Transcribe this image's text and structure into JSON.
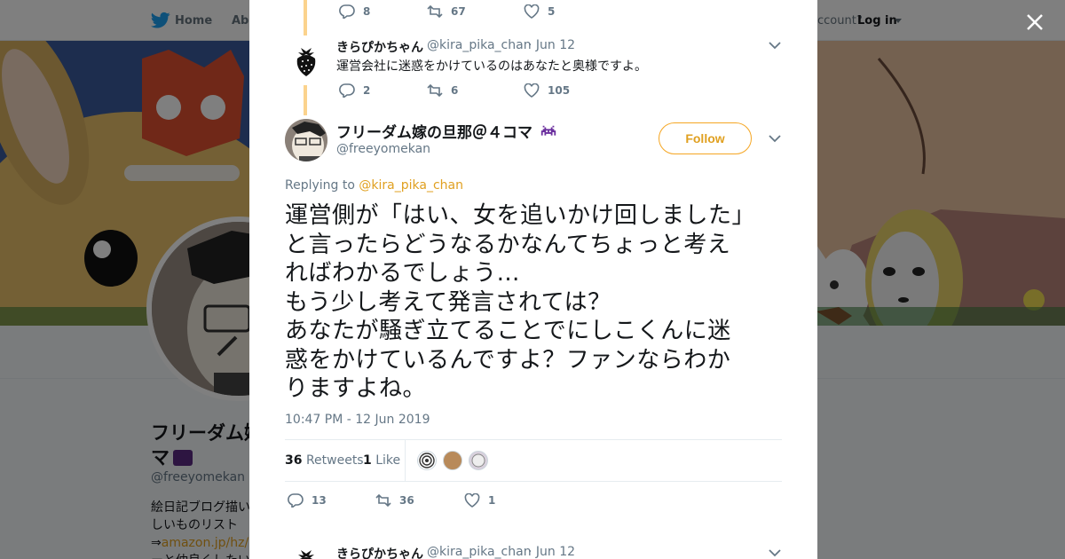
{
  "nav": {
    "home_label": "Home",
    "about_label": "Abo",
    "account_text": "ccount?",
    "login_label": "Log in"
  },
  "profile": {
    "name_line1": "フリーダム嫁",
    "name_line2": "マ",
    "handle": "@freeyomekan",
    "bio_line1": "絵日記ブログ描い",
    "bio_line2": "しいものリスト",
    "bio_line3_prefix": "⇒",
    "bio_link": "amazon.jp/hz/wi",
    "bio_line4": "ーと仲良くしたい"
  },
  "thread": {
    "top_actions": {
      "replies": "8",
      "retweets": "67",
      "likes": "5"
    },
    "reply1": {
      "name": "きらぴかちゃん",
      "handle": "@kira_pika_chan",
      "date": "· Jun 12",
      "text": "運営会社に迷惑をかけているのはあなたと奥様ですよ。",
      "actions": {
        "replies": "2",
        "retweets": "6",
        "likes": "105"
      }
    },
    "main": {
      "name": "フリーダム嫁の旦那＠４コマ",
      "handle": "@freeyomekan",
      "follow_label": "Follow",
      "replying_prefix": "Replying to",
      "replying_handle": "@kira_pika_chan",
      "text": "運営側が「はい、女を追いかけ回しました」\nと言ったらどうなるかなんてちょっと考え\nればわかるでしょう…\nもう少し考えて発言されては？\nあなたが騒ぎ立てることでにしこくんに迷\n惑をかけているんですよ？ファンならわか\nりますよね。",
      "timestamp": "10:47 PM - 12 Jun 2019",
      "retweets_count": "36",
      "retweets_label": "Retweets",
      "likes_count": "1",
      "likes_label": "Like",
      "actions": {
        "replies": "13",
        "retweets": "36",
        "likes": "1"
      }
    },
    "reply2": {
      "name": "きらぴかちゃん",
      "handle": "@kira_pika_chan",
      "date": "· Jun 12"
    }
  },
  "colors": {
    "accent": "#e0a020",
    "thread_line": "#fbd38d",
    "overlay": "rgba(0,0,0,0.5)"
  }
}
